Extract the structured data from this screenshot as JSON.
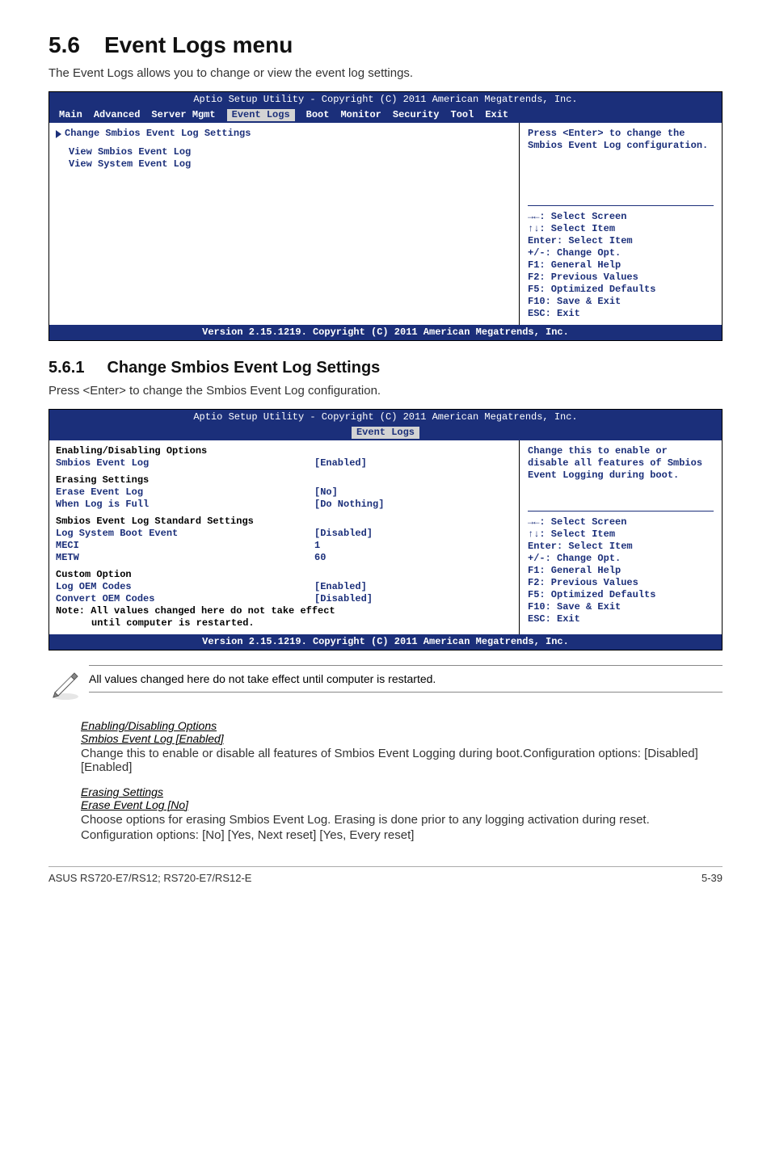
{
  "doc": {
    "section_num": "5.6",
    "section_title": "Event Logs menu",
    "intro": "The Event Logs allows you to change or view the event log settings.",
    "sub_num": "5.6.1",
    "sub_title": "Change Smbios Event Log Settings",
    "sub_intro": "Press <Enter> to change the Smbios Event Log configuration.",
    "note": "All values changed here do not take effect until computer is restarted.",
    "footer_left": "ASUS RS720-E7/RS12; RS720-E7/RS12-E",
    "footer_right": "5-39"
  },
  "bios1": {
    "header": "Aptio Setup Utility - Copyright (C) 2011 American Megatrends, Inc.",
    "menu": [
      "Main",
      "Advanced",
      "Server Mgmt",
      "Event Logs",
      "Boot",
      "Monitor",
      "Security",
      "Tool",
      "Exit"
    ],
    "active_tab": "Event Logs",
    "left0": "Change Smbios Event Log Settings",
    "left1": "View Smbios Event Log",
    "left2": "View System Event Log",
    "help1": "Press <Enter> to change the Smbios Event Log configuration.",
    "hints": [
      "→←: Select Screen",
      "↑↓:  Select Item",
      "Enter: Select Item",
      "+/-: Change Opt.",
      "F1: General Help",
      "F2: Previous Values",
      "F5: Optimized Defaults",
      "F10: Save & Exit",
      "ESC: Exit"
    ],
    "footer": "Version 2.15.1219. Copyright (C) 2011 American Megatrends, Inc."
  },
  "bios2": {
    "header": "Aptio Setup Utility - Copyright (C) 2011 American Megatrends, Inc.",
    "active_tab": "Event Logs",
    "rows": {
      "g1": "Enabling/Disabling Options",
      "r1l": "Smbios Event Log",
      "r1v": "[Enabled]",
      "g2": "Erasing Settings",
      "r2l": "Erase Event Log",
      "r2v": "[No]",
      "r3l": "When Log is Full",
      "r3v": "[Do Nothing]",
      "g3": "Smbios Event Log Standard Settings",
      "r4l": "Log System Boot Event",
      "r4v": "[Disabled]",
      "r5l": "MECI",
      "r5v": "1",
      "r6l": "METW",
      "r6v": "60",
      "g4": "Custom Option",
      "r7l": "Log OEM Codes",
      "r7v": "[Enabled]",
      "r8l": "Convert OEM Codes",
      "r8v": "[Disabled]",
      "note1": "Note: All values changed here do not take effect",
      "note2": "until computer is restarted."
    },
    "help1": "Change this to enable or disable all features of Smbios Event Logging during boot.",
    "hints": [
      "→←: Select Screen",
      "↑↓:  Select Item",
      "Enter: Select Item",
      "+/-: Change Opt.",
      "F1: General Help",
      "F2: Previous Values",
      "F5: Optimized Defaults",
      "F10: Save & Exit",
      "ESC: Exit"
    ],
    "footer": "Version 2.15.1219. Copyright (C) 2011 American Megatrends, Inc."
  },
  "opts": {
    "h1a": "Enabling/Disabling Options",
    "h1b": "Smbios Event Log [Enabled]",
    "b1": "Change this to enable or disable all features of Smbios Event Logging during boot.Configuration options: [Disabled] [Enabled]",
    "h2a": "Erasing Settings",
    "h2b": "Erase Event Log [No]",
    "b2a": "Choose options for erasing Smbios Event Log. Erasing is done prior to any logging activation during reset.",
    "b2b": "Configuration options: [No] [Yes, Next reset] [Yes, Every reset]"
  }
}
